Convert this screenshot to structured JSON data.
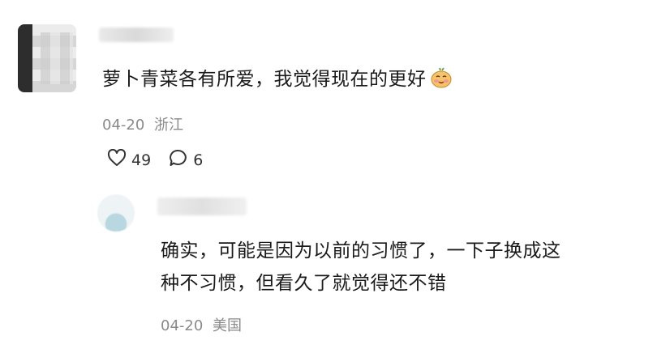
{
  "comment": {
    "text": "萝卜青菜各有所爱，我觉得现在的更好",
    "date": "04-20",
    "location": "浙江",
    "likes": "49",
    "replies": "6"
  },
  "reply": {
    "line1": "确实，可能是因为以前的习惯了，一下子换成这",
    "line2": "种不习惯，但看久了就觉得还不错",
    "date": "04-20",
    "location": "美国"
  }
}
